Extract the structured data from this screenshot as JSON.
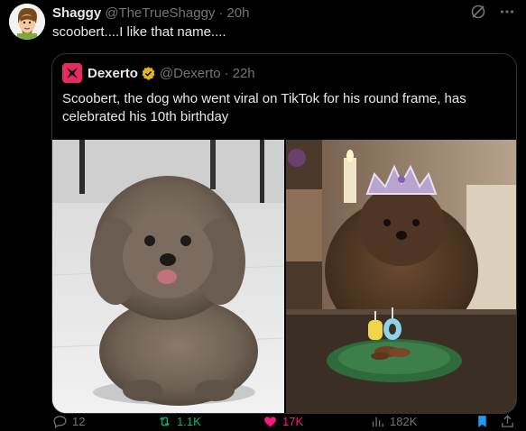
{
  "tweet": {
    "display_name": "Shaggy",
    "handle": "@TheTrueShaggy",
    "separator": "·",
    "time": "20h",
    "text": "scoobert....I like that name...."
  },
  "top_icons": [
    "grok-icon",
    "more-icon"
  ],
  "quote": {
    "display_name": "Dexerto",
    "handle": "@Dexerto",
    "separator": "·",
    "time": "22h",
    "text": "Scoobert, the dog who went viral on TikTok for his round frame, has celebrated his 10th birthday",
    "candle_number": "10",
    "verified_color": "#e2b719"
  },
  "actions": {
    "replies": "12",
    "reposts": "1.1K",
    "likes": "17K",
    "views": "182K"
  },
  "colors": {
    "background": "#000000",
    "text": "#e7e9ea",
    "muted": "#71767b",
    "border": "#2f3336",
    "repost_green": "#00ba7c",
    "like_pink": "#f91880",
    "bookmark_blue": "#1d9bf0",
    "dexerto_red": "#e42c5e"
  }
}
